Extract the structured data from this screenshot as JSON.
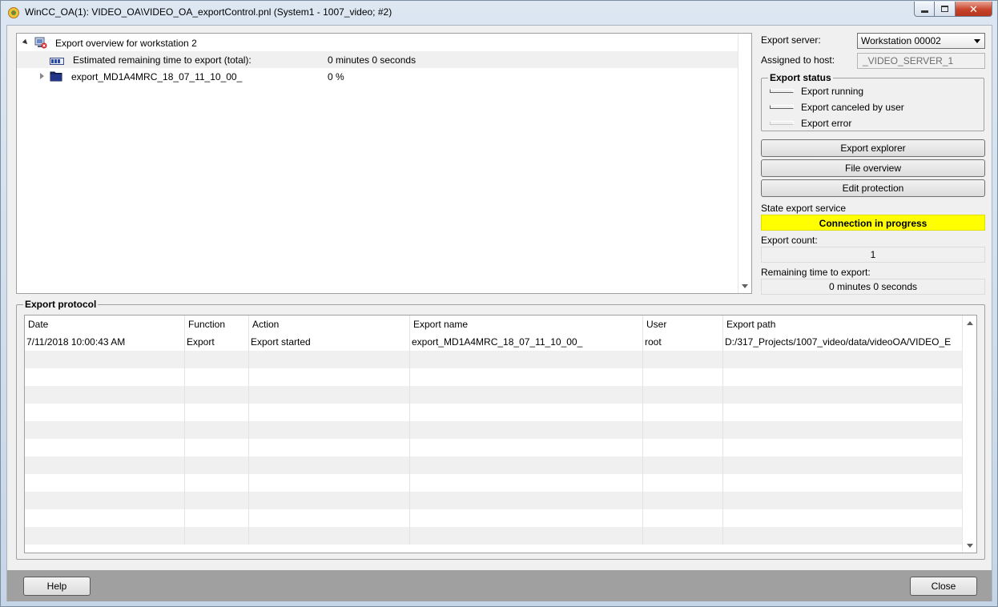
{
  "window": {
    "title": "WinCC_OA(1): VIDEO_OA\\VIDEO_OA_exportControl.pnl (System1 - 1007_video; #2)"
  },
  "tree": {
    "root_label": "Export overview for workstation 2",
    "estimate_label": "Estimated remaining time to export (total):",
    "estimate_value": "0 minutes  0 seconds",
    "item_label": "export_MD1A4MRC_18_07_11_10_00_",
    "item_value": "0 %"
  },
  "server": {
    "export_server_label": "Export server:",
    "export_server_value": "Workstation  00002",
    "assigned_host_label": "Assigned to host:",
    "assigned_host_value": "_VIDEO_SERVER_1"
  },
  "export_status": {
    "title": "Export status",
    "items": [
      "Export running",
      "Export canceled by user",
      "Export error"
    ]
  },
  "buttons": {
    "export_explorer": "Export explorer",
    "file_overview": "File overview",
    "edit_protection": "Edit protection",
    "help": "Help",
    "close": "Close"
  },
  "state": {
    "service_label": "State export service",
    "service_value": "Connection in progress",
    "service_color": "#ffff00",
    "count_label": "Export count:",
    "count_value": "1",
    "remaining_label": "Remaining time to export:",
    "remaining_value": "0 minutes  0 seconds"
  },
  "protocol": {
    "title": "Export protocol",
    "columns": [
      "Date",
      "Function",
      "Action",
      "Export name",
      "User",
      "Export path"
    ],
    "rows": [
      [
        "7/11/2018 10:00:43 AM",
        "Export",
        "Export started",
        "export_MD1A4MRC_18_07_11_10_00_",
        "root",
        "D:/317_Projects/1007_video/data/videoOA/VIDEO_E"
      ]
    ]
  }
}
